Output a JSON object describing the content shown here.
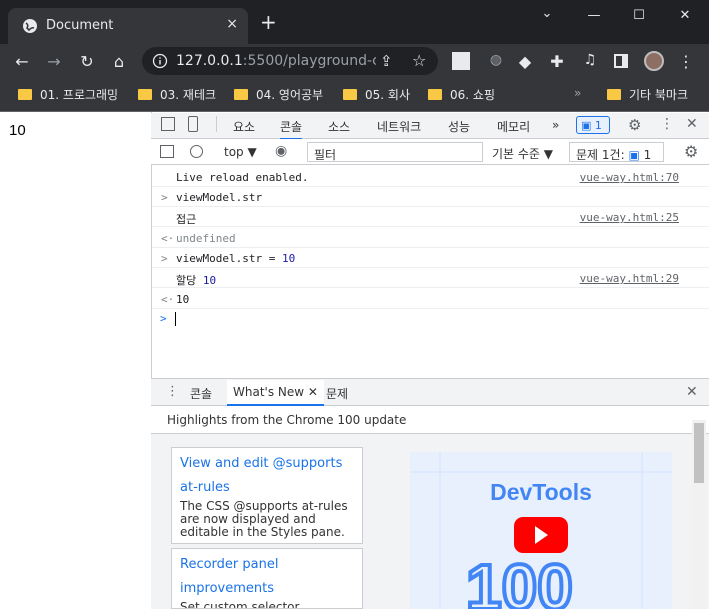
{
  "browser": {
    "tab_title": "Document",
    "close_tab": "×",
    "new_tab": "+",
    "window": {
      "minimize": "—",
      "maximize": "☐",
      "close": "✕"
    },
    "url_host": "127.0.0.1",
    "url_rest": ":5500/playground-c...",
    "bookmarks": [
      "01. 프로그래밍",
      "03. 재테크",
      "04. 영어공부",
      "05. 회사",
      "06. 쇼핑"
    ],
    "bookmarks_more": "»",
    "other_bookmarks": "기타 북마크"
  },
  "page": {
    "value": "10"
  },
  "devtools": {
    "tabs": [
      "요소",
      "콘솔",
      "소스",
      "네트워크",
      "성능",
      "메모리"
    ],
    "more_tabs": "»",
    "issues_badge": "1",
    "console_toolbar": {
      "context": "top",
      "filter_placeholder": "필터",
      "level": "기본 수준 ▼",
      "issues": "문제 1건:",
      "issues_count": "1"
    },
    "console_lines": [
      {
        "arrow": "",
        "text": "Live reload enabled.",
        "source": "vue-way.html:70"
      },
      {
        "arrow": ">",
        "text": "viewModel.str",
        "source": ""
      },
      {
        "arrow": "",
        "text": "접근",
        "source": "vue-way.html:25"
      },
      {
        "arrow": "<·",
        "text": "undefined",
        "source": ""
      },
      {
        "arrow": ">",
        "text": "viewModel.str = ",
        "num": "10",
        "source": ""
      },
      {
        "arrow": "",
        "text": "할당 ",
        "num": "10",
        "source": "vue-way.html:29"
      },
      {
        "arrow": "<·",
        "text": "",
        "num": "10",
        "source": ""
      }
    ],
    "prompt": ">",
    "drawer": {
      "tabs": [
        "콘솔",
        "What's New",
        "문제"
      ],
      "highlights": "Highlights from the Chrome 100 update",
      "cards": [
        {
          "title": "View and edit @supports",
          "title2": "at-rules",
          "desc": "The CSS @supports at-rules are now displayed and editable in the Styles pane."
        },
        {
          "title": "Recorder panel",
          "title2": "improvements",
          "desc": "Set custom selector attribute"
        }
      ],
      "promo_title": "DevTools",
      "promo_version": "100"
    }
  },
  "colors": {
    "accent": "#1a73e8",
    "promo_blue": "#4285f4",
    "youtube_red": "#ff0000"
  }
}
